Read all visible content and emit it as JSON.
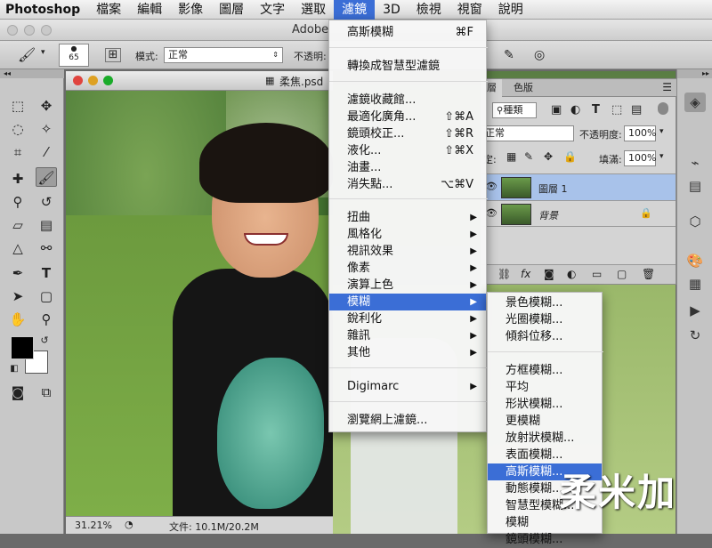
{
  "menubar": {
    "items": [
      "Photoshop",
      "檔案",
      "編輯",
      "影像",
      "圖層",
      "文字",
      "選取",
      "濾鏡",
      "3D",
      "檢視",
      "視窗",
      "說明"
    ]
  },
  "window_title": "Adobe",
  "options": {
    "brush_size": "65",
    "mode_label": "模式:",
    "mode_value": "正常",
    "opacity_label": "不透明:"
  },
  "document": {
    "title": "柔焦.psd",
    "zoom": "31.21%",
    "file_info": "文件: 10.1M/20.2M"
  },
  "layers_panel": {
    "tabs": [
      "層",
      "色版"
    ],
    "kind": "種類",
    "blend": "正常",
    "opacity_label": "不透明度:",
    "opacity": "100%",
    "lock_label": "定:",
    "fill_label": "填滿:",
    "fill": "100%",
    "layers": [
      "圖層 1",
      "背景"
    ]
  },
  "filter_menu": {
    "items": [
      {
        "label": "高斯模糊",
        "shortcut": "⌘F"
      },
      {
        "label": "轉換成智慧型濾鏡"
      },
      {
        "label": "濾鏡收藏館..."
      },
      {
        "label": "最適化廣角...",
        "shortcut": "⇧⌘A"
      },
      {
        "label": "鏡頭校正...",
        "shortcut": "⇧⌘R"
      },
      {
        "label": "液化...",
        "shortcut": "⇧⌘X"
      },
      {
        "label": "油畫..."
      },
      {
        "label": "消失點...",
        "shortcut": "⌥⌘V"
      },
      {
        "label": "扭曲",
        "sub": true
      },
      {
        "label": "風格化",
        "sub": true
      },
      {
        "label": "視訊效果",
        "sub": true
      },
      {
        "label": "像素",
        "sub": true
      },
      {
        "label": "演算上色",
        "sub": true
      },
      {
        "label": "模糊",
        "sub": true,
        "selected": true
      },
      {
        "label": "銳利化",
        "sub": true
      },
      {
        "label": "雜訊",
        "sub": true
      },
      {
        "label": "其他",
        "sub": true
      },
      {
        "label": "Digimarc",
        "sub": true
      },
      {
        "label": "瀏覽網上濾鏡..."
      }
    ]
  },
  "blur_submenu": {
    "items": [
      "景色模糊...",
      "光圈模糊...",
      "傾斜位移...",
      "方框模糊...",
      "平均",
      "形狀模糊...",
      "更模糊",
      "放射狀模糊...",
      "表面模糊...",
      "高斯模糊...",
      "動態模糊...",
      "智慧型模糊...",
      "模糊",
      "鏡頭模糊..."
    ],
    "selected_index": 9
  },
  "watermark": "柔米加"
}
